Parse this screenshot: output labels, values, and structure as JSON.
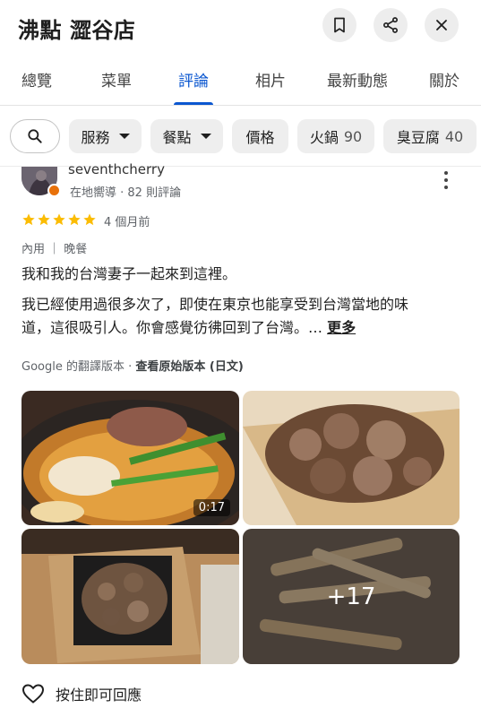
{
  "header": {
    "title": "沸點 澀谷店",
    "icons": [
      "bookmark-icon",
      "share-icon",
      "close-icon"
    ]
  },
  "tabs": [
    {
      "label": "總覽",
      "active": false
    },
    {
      "label": "菜單",
      "active": false
    },
    {
      "label": "評論",
      "active": true
    },
    {
      "label": "相片",
      "active": false
    },
    {
      "label": "最新動態",
      "active": false
    },
    {
      "label": "關於",
      "active": false
    }
  ],
  "filters": {
    "search_icon": "search-icon",
    "chips": [
      {
        "label": "服務",
        "dropdown": true
      },
      {
        "label": "餐點",
        "dropdown": true
      },
      {
        "label": "價格",
        "dropdown": false
      },
      {
        "label": "火鍋",
        "count": "90"
      },
      {
        "label": "臭豆腐",
        "count": "40"
      }
    ]
  },
  "review": {
    "author": "seventhcherry",
    "author_meta": "在地嚮導 · 82 則評論",
    "rating": 5,
    "age": "4 個月前",
    "meal": "內用 ｜ 晚餐",
    "text_line1": "我和我的台灣妻子一起來到這裡。",
    "text_line2": "我已經使用過很多次了，即使在東京也能享受到台灣當地的味",
    "text_line3": "道，這很吸引人。你會感覺彷彿回到了台灣。…",
    "more_label": "更多",
    "translation_note": "Google 的翻譯版本 · ",
    "translation_link": "查看原始版本 (日文)",
    "photos": [
      {
        "desc": "hotpot",
        "video_duration": "0:17"
      },
      {
        "desc": "fried-chicken-bowl"
      },
      {
        "desc": "fried-chicken-plate"
      },
      {
        "desc": "fries",
        "more_count": "+17"
      }
    ],
    "like_label": "按住即可回應"
  },
  "colors": {
    "accent": "#0b57d0",
    "star": "#fbbc04",
    "chip_bg": "#eeeeee",
    "badge": "#e8710a"
  }
}
